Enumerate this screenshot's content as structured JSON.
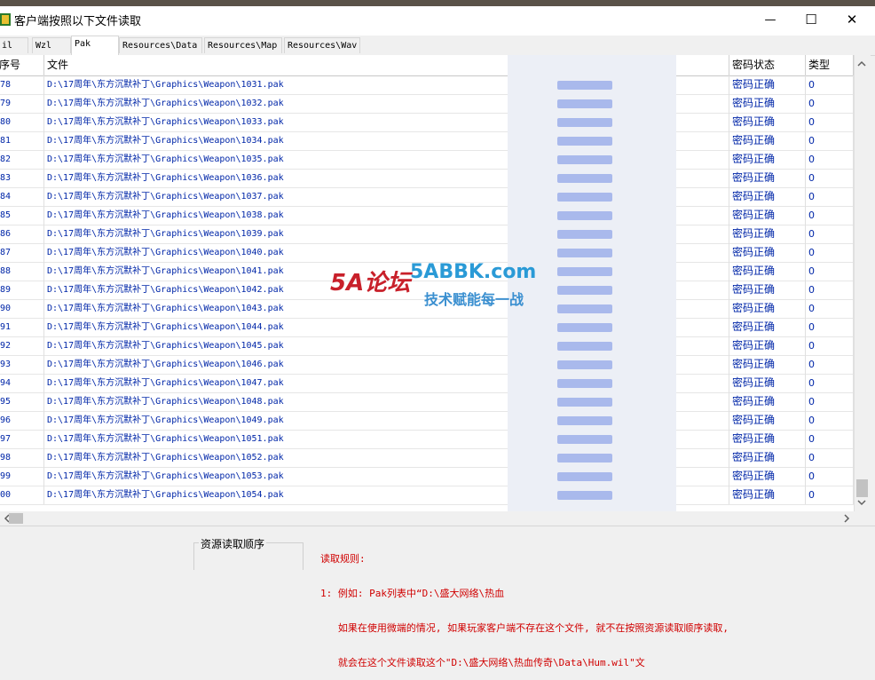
{
  "window": {
    "title": "客户端按照以下文件读取",
    "minimize": "—",
    "maximize": "☐",
    "close": "✕"
  },
  "tabs": [
    {
      "label": "il",
      "active": false
    },
    {
      "label": "Wzl",
      "active": false
    },
    {
      "label": "Pak",
      "active": true
    },
    {
      "label": "Resources\\Data",
      "active": false
    },
    {
      "label": "Resources\\Map",
      "active": false
    },
    {
      "label": "Resources\\Wav",
      "active": false
    }
  ],
  "table": {
    "columns": {
      "idx": "序号",
      "file": "文件",
      "hidden": "",
      "password": "密码状态",
      "type": "类型"
    },
    "rows": [
      {
        "idx": "78",
        "file": "D:\\17周年\\东方沉默补丁\\Graphics\\Weapon\\1031.pak",
        "password": "密码正确",
        "type": "0"
      },
      {
        "idx": "79",
        "file": "D:\\17周年\\东方沉默补丁\\Graphics\\Weapon\\1032.pak",
        "password": "密码正确",
        "type": "0"
      },
      {
        "idx": "80",
        "file": "D:\\17周年\\东方沉默补丁\\Graphics\\Weapon\\1033.pak",
        "password": "密码正确",
        "type": "0"
      },
      {
        "idx": "81",
        "file": "D:\\17周年\\东方沉默补丁\\Graphics\\Weapon\\1034.pak",
        "password": "密码正确",
        "type": "0"
      },
      {
        "idx": "82",
        "file": "D:\\17周年\\东方沉默补丁\\Graphics\\Weapon\\1035.pak",
        "password": "密码正确",
        "type": "0"
      },
      {
        "idx": "83",
        "file": "D:\\17周年\\东方沉默补丁\\Graphics\\Weapon\\1036.pak",
        "password": "密码正确",
        "type": "0"
      },
      {
        "idx": "84",
        "file": "D:\\17周年\\东方沉默补丁\\Graphics\\Weapon\\1037.pak",
        "password": "密码正确",
        "type": "0"
      },
      {
        "idx": "85",
        "file": "D:\\17周年\\东方沉默补丁\\Graphics\\Weapon\\1038.pak",
        "password": "密码正确",
        "type": "0"
      },
      {
        "idx": "86",
        "file": "D:\\17周年\\东方沉默补丁\\Graphics\\Weapon\\1039.pak",
        "password": "密码正确",
        "type": "0"
      },
      {
        "idx": "87",
        "file": "D:\\17周年\\东方沉默补丁\\Graphics\\Weapon\\1040.pak",
        "password": "密码正确",
        "type": "0"
      },
      {
        "idx": "88",
        "file": "D:\\17周年\\东方沉默补丁\\Graphics\\Weapon\\1041.pak",
        "password": "密码正确",
        "type": "0"
      },
      {
        "idx": "89",
        "file": "D:\\17周年\\东方沉默补丁\\Graphics\\Weapon\\1042.pak",
        "password": "密码正确",
        "type": "0"
      },
      {
        "idx": "90",
        "file": "D:\\17周年\\东方沉默补丁\\Graphics\\Weapon\\1043.pak",
        "password": "密码正确",
        "type": "0"
      },
      {
        "idx": "91",
        "file": "D:\\17周年\\东方沉默补丁\\Graphics\\Weapon\\1044.pak",
        "password": "密码正确",
        "type": "0"
      },
      {
        "idx": "92",
        "file": "D:\\17周年\\东方沉默补丁\\Graphics\\Weapon\\1045.pak",
        "password": "密码正确",
        "type": "0"
      },
      {
        "idx": "93",
        "file": "D:\\17周年\\东方沉默补丁\\Graphics\\Weapon\\1046.pak",
        "password": "密码正确",
        "type": "0"
      },
      {
        "idx": "94",
        "file": "D:\\17周年\\东方沉默补丁\\Graphics\\Weapon\\1047.pak",
        "password": "密码正确",
        "type": "0"
      },
      {
        "idx": "95",
        "file": "D:\\17周年\\东方沉默补丁\\Graphics\\Weapon\\1048.pak",
        "password": "密码正确",
        "type": "0"
      },
      {
        "idx": "96",
        "file": "D:\\17周年\\东方沉默补丁\\Graphics\\Weapon\\1049.pak",
        "password": "密码正确",
        "type": "0"
      },
      {
        "idx": "97",
        "file": "D:\\17周年\\东方沉默补丁\\Graphics\\Weapon\\1051.pak",
        "password": "密码正确",
        "type": "0"
      },
      {
        "idx": "98",
        "file": "D:\\17周年\\东方沉默补丁\\Graphics\\Weapon\\1052.pak",
        "password": "密码正确",
        "type": "0"
      },
      {
        "idx": "99",
        "file": "D:\\17周年\\东方沉默补丁\\Graphics\\Weapon\\1053.pak",
        "password": "密码正确",
        "type": "0"
      },
      {
        "idx": "00",
        "file": "D:\\17周年\\东方沉默补丁\\Graphics\\Weapon\\1054.pak",
        "password": "密码正确",
        "type": "0"
      }
    ]
  },
  "bottom": {
    "group_label": "资源读取顺序",
    "rules_lines": [
      "读取规则:",
      "1: 例如: Pak列表中“D:\\盛大网络\\热血",
      "   如果在使用微端的情况, 如果玩家客户端不存在这个文件, 就不在按照资源读取顺序读取,",
      "   就会在这个文件读取这个\"D:\\盛大网络\\热血传奇\\Data\\Hum.wil\"文"
    ]
  },
  "watermark": {
    "left": "5A论坛",
    "right_top": "5ABBK.com",
    "right_bottom": "技术赋能每一战"
  },
  "colors": {
    "row_text": "#0026a8",
    "rules_text": "#d00000",
    "blur": "#93a7e8"
  }
}
